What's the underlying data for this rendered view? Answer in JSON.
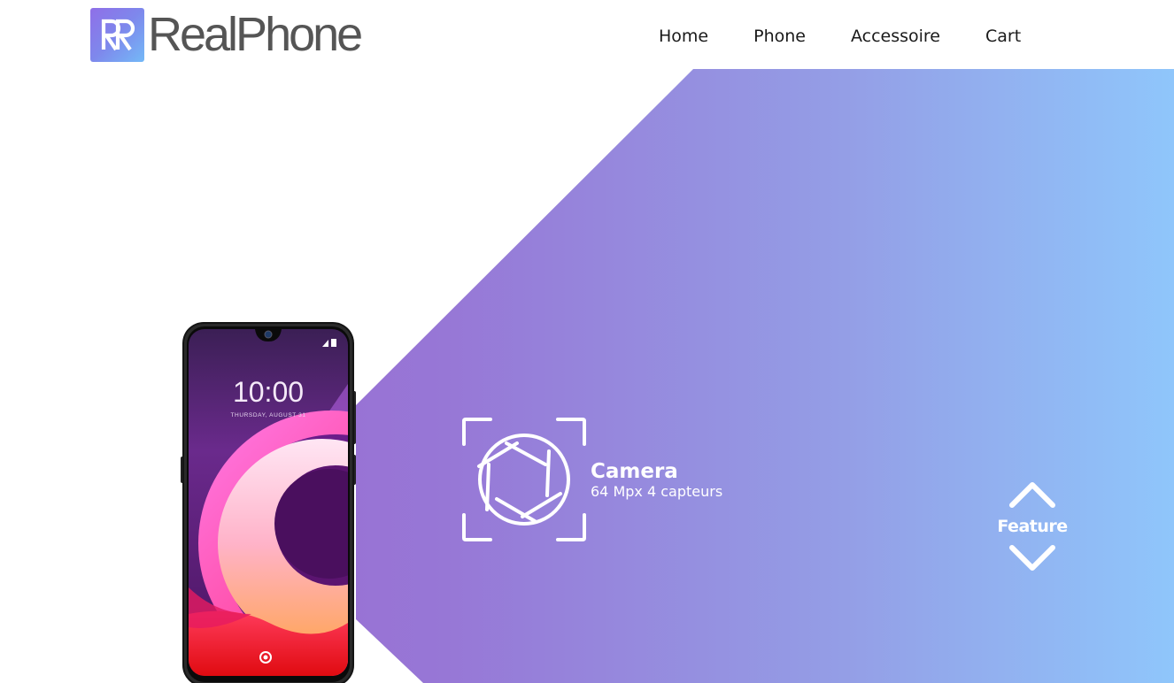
{
  "brand": {
    "name": "RealPhone",
    "logo_letters": "RR"
  },
  "nav": {
    "items": [
      {
        "label": "Home"
      },
      {
        "label": "Phone"
      },
      {
        "label": "Accessoire"
      },
      {
        "label": "Cart"
      }
    ]
  },
  "hero": {
    "phone_screen": {
      "time": "10:00",
      "date": "THURSDAY, AUGUST 31"
    },
    "feature": {
      "icon": "camera-aperture-icon",
      "title": "Camera",
      "subtitle": "64 Mpx 4 capteurs"
    },
    "switcher": {
      "label": "Feature",
      "up_icon": "chevron-up-icon",
      "down_icon": "chevron-down-icon"
    }
  },
  "colors": {
    "gradient_start": "#9b63cf",
    "gradient_end": "#8fc6fb",
    "logo_text": "#555555",
    "nav_text": "#1a1a1a"
  }
}
